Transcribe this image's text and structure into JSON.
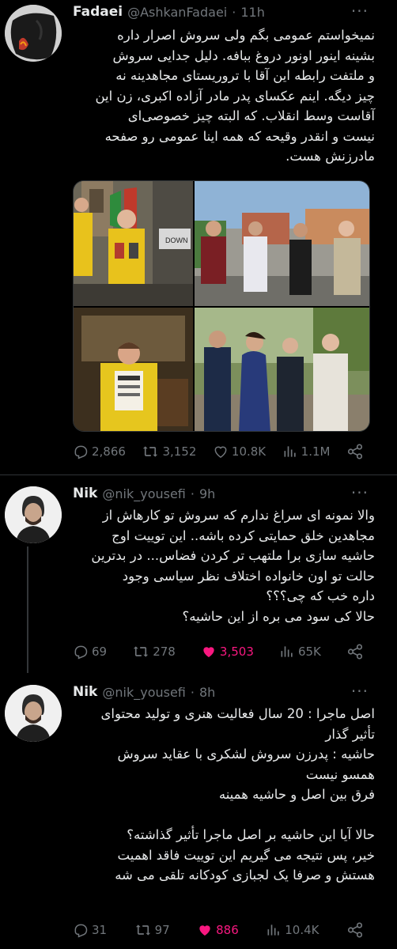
{
  "tweets": [
    {
      "name": "Fadaei",
      "handle": "@AshkanFadaei",
      "time": "11h",
      "text": "نمیخواستم عمومی بگم ولی سروش اصرار داره\nبشینه اینور اونور دروغ ببافه. دلیل جدایی سروش\nو ملتفت رابطه این آقا با تروریستای مجاهدینه نه\nچیز دیگه. اینم عکسای پدر مادر آزاده اکبری، زن این\nآقاست وسط انقلاب. که البته چیز خصوصی‌ای\nنیست و انقدر وقیحه که همه اینا عمومی رو صفحه\nمادرزنش هست.",
      "stats": {
        "replies": "2,866",
        "retweets": "3,152",
        "likes": "10.8K",
        "views": "1.1M"
      }
    },
    {
      "name": "Nik",
      "handle": "@nik_yousefi",
      "time": "9h",
      "text": "والا نمونه ای سراغ ندارم که سروش تو کارهاش از\nمجاهدین خلق حمایتی کرده باشه.. این توییت اوج\nحاشیه سازی برا ملتهب تر کردن فضاس... در بدترین\nحالت تو اون خانواده اختلاف نظر سیاسی وجود\nداره خب که چی؟؟؟\nحالا کی سود می بره از این حاشیه؟",
      "stats": {
        "replies": "69",
        "retweets": "278",
        "likes": "3,503",
        "views": "65K"
      }
    },
    {
      "name": "Nik",
      "handle": "@nik_yousefi",
      "time": "8h",
      "text": "اصل ماجرا : 20 سال فعالیت هنری و تولید محتوای\nتأثیر گذار\nحاشیه : پدرزن سروش لشکری با عقاید سروش\nهمسو نیست\nفرق بین اصل و حاشیه همینه\n\nحالا آیا این حاشیه بر اصل ماجرا تأثیر گذاشته؟\nخیر، پس نتیجه می گیریم این توییت فاقد اهمیت\nهستش و صرفا یک لجبازی کودکانه تلقی می شه",
      "stats": {
        "replies": "31",
        "retweets": "97",
        "likes": "886",
        "views": "10.4K"
      }
    }
  ],
  "colors": {
    "background": "#000000",
    "text": "#e7e9ea",
    "muted": "#71767b",
    "like_active": "#f91880",
    "divider": "#2f3336"
  },
  "media_photo_sign_text": "DOWN",
  "icons": {
    "reply": "reply-icon",
    "retweet": "retweet-icon",
    "like": "heart-icon",
    "views": "views-icon",
    "share": "share-icon",
    "more": "more-icon"
  }
}
